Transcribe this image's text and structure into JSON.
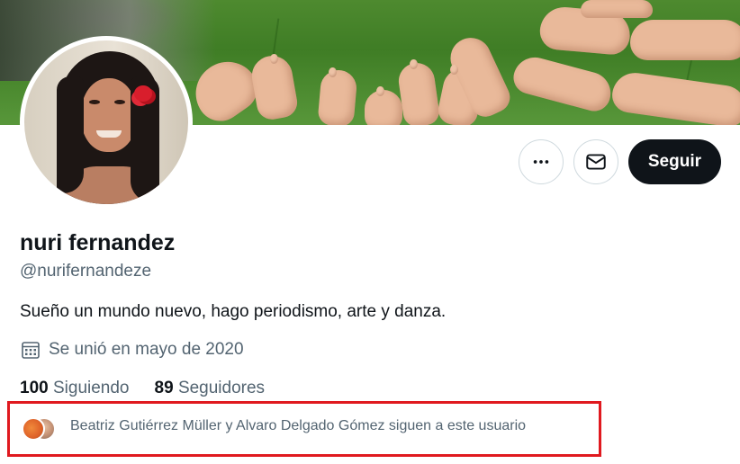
{
  "profile": {
    "name": "nuri fernandez",
    "handle": "@nurifernandeze",
    "bio": "Sueño un mundo nuevo, hago periodismo, arte y danza.",
    "joined": "Se unió en mayo de 2020"
  },
  "actions": {
    "more_icon": "more-horizontal-icon",
    "message_icon": "envelope-icon",
    "follow_label": "Seguir"
  },
  "stats": {
    "following_count": "100",
    "following_label": "Siguiendo",
    "followers_count": "89",
    "followers_label": "Seguidores"
  },
  "followed_by": {
    "text": "Beatriz Gutiérrez Müller y Alvaro Delgado Gómez siguen a este usuario",
    "highlight_color": "#e0191f"
  },
  "colors": {
    "primary_text": "#0f1419",
    "secondary_text": "#536471",
    "follow_button_bg": "#0f1419"
  }
}
